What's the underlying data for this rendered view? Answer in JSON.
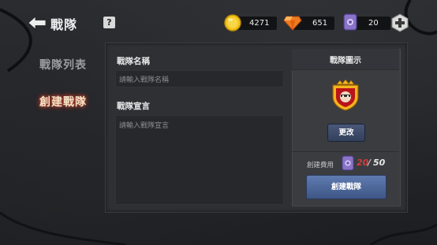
{
  "header": {
    "title": "戰隊",
    "help_label": "?"
  },
  "resources": {
    "gold": "4271",
    "gems": "651",
    "tickets": "20"
  },
  "sidebar": {
    "items": [
      {
        "label": "戰隊列表",
        "active": false
      },
      {
        "label": "創建戰隊",
        "active": true
      }
    ]
  },
  "form": {
    "name_label": "戰隊名稱",
    "name_placeholder": "請輸入戰隊名稱",
    "desc_label": "戰隊宣言",
    "desc_placeholder": "請輸入戰隊宣言"
  },
  "emblem": {
    "title": "戰隊圖示",
    "change_label": "更改"
  },
  "cost": {
    "label": "創建費用",
    "current": "20",
    "separator": "/",
    "max": "50"
  },
  "create_button": "創建戰隊",
  "colors": {
    "accent_red": "#d43c3c",
    "button_blue": "#4a68a0",
    "gold": "#f5c518",
    "gem": "#f07a1e",
    "ticket": "#8a74c8"
  }
}
